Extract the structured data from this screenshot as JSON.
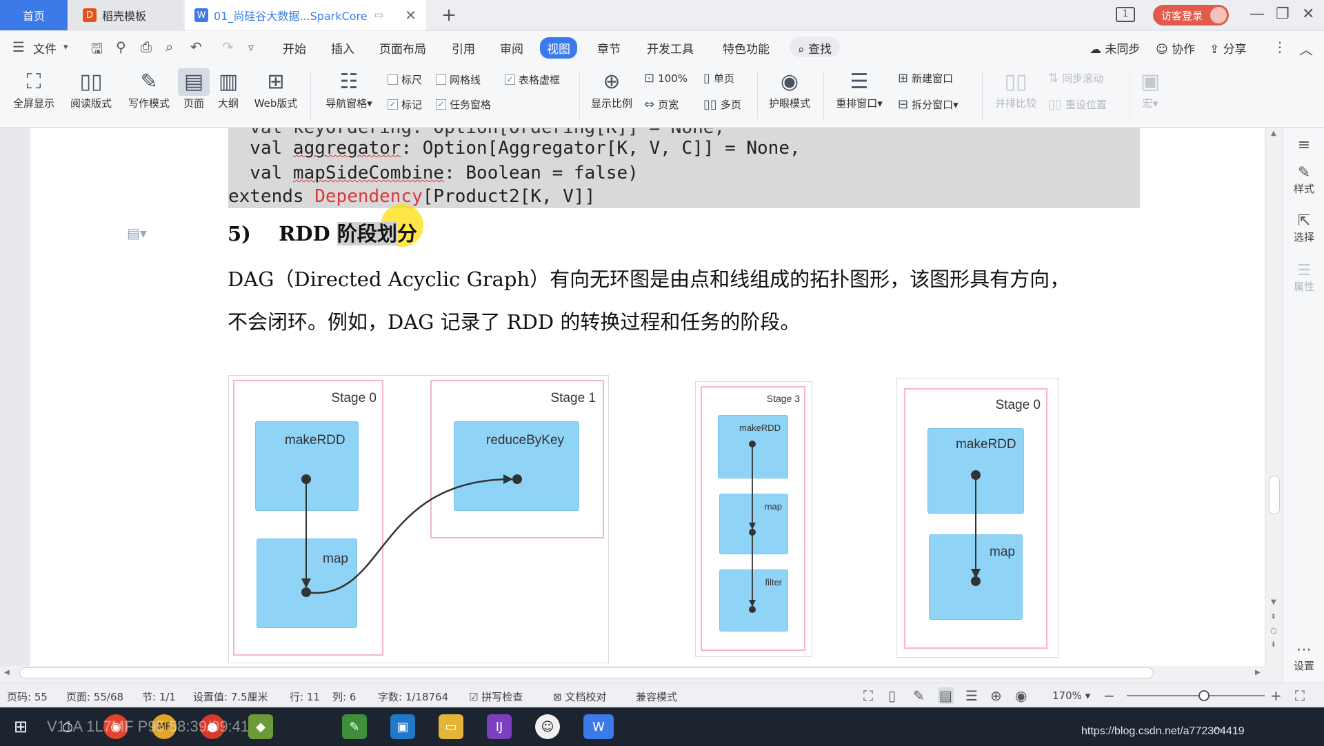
{
  "tabs": {
    "home": "首页",
    "template": "稻壳模板",
    "doc": "01_尚硅谷大数据...SparkCore",
    "add": "+"
  },
  "topright": {
    "page_indicator": "1",
    "login": "访客登录"
  },
  "menu": {
    "file": "文件",
    "items": [
      "开始",
      "插入",
      "页面布局",
      "引用",
      "审阅",
      "视图",
      "章节",
      "开发工具",
      "特色功能"
    ],
    "search": "查找",
    "sync": "未同步",
    "collab": "协作",
    "share": "分享"
  },
  "ribbon": {
    "fullscreen": "全屏显示",
    "reading": "阅读版式",
    "writing": "写作模式",
    "page": "页面",
    "outline": "大纲",
    "web": "Web版式",
    "nav_pane": "导航窗格",
    "ruler": "标尺",
    "gridlines": "网格线",
    "table_grid": "表格虚框",
    "marks": "标记",
    "task_pane": "任务窗格",
    "zoom_ratio": "显示比例",
    "zoom_100": "100%",
    "page_width": "页宽",
    "single_page": "单页",
    "multi_page": "多页",
    "eye_mode": "护眼模式",
    "rearrange": "重排窗口",
    "new_window": "新建窗口",
    "split_window": "拆分窗口",
    "side_by_side": "并排比较",
    "sync_scroll": "同步滚动",
    "reset_pos": "重设位置",
    "macro": "宏"
  },
  "document": {
    "code_lines": [
      "  val keyOrdering: Option[Ordering[K]] = None,",
      "  val aggregator: Option[Aggregator[K, V, C]] = None,",
      "  val mapSideCombine: Boolean = false)"
    ],
    "code_extends": "extends ",
    "code_dependency": "Dependency",
    "code_product": "[Product2[K, V]]",
    "heading_num": "5)",
    "heading_rdd": "RDD",
    "heading_hl": "阶段划",
    "heading_rest": "分",
    "para1": "DAG（Directed Acyclic Graph）有向无环图是由点和线组成的拓扑图形，该图形具有方向，",
    "para2": "不会闭环。例如，DAG 记录了 RDD 的转换过程和任务的阶段。"
  },
  "diagrams": {
    "d1_stage0": "Stage 0",
    "d1_stage1": "Stage 1",
    "d1_makeRDD": "makeRDD",
    "d1_map": "map",
    "d1_reduce": "reduceByKey",
    "d2_stage3": "Stage 3",
    "d2_makeRDD": "makeRDD",
    "d2_map": "map",
    "d2_filter": "filter",
    "d3_stage0": "Stage 0",
    "d3_makeRDD": "makeRDD",
    "d3_map": "map"
  },
  "rightpanel": {
    "style": "样式",
    "select": "选择",
    "property": "属性",
    "settings": "设置"
  },
  "status": {
    "page_no": "页码: 55",
    "pages": "页面: 55/68",
    "section": "节: 1/1",
    "setting": "设置值: 7.5厘米",
    "row": "行: 11",
    "col": "列: 6",
    "words": "字数: 1/18764",
    "spell": "拼写检查",
    "proof": "文档校对",
    "compat": "兼容模式",
    "zoom": "170%"
  },
  "taskbar": {
    "overlay": "V11A   1L7MF P95 58:39/09:41",
    "watermark": "https://blog.csdn.net/a772304419"
  },
  "colors": {
    "accent": "#3b7ae8",
    "login": "#e15a4b",
    "stage_border": "#f5b8c3",
    "rdd_fill": "#8fd3f7"
  }
}
